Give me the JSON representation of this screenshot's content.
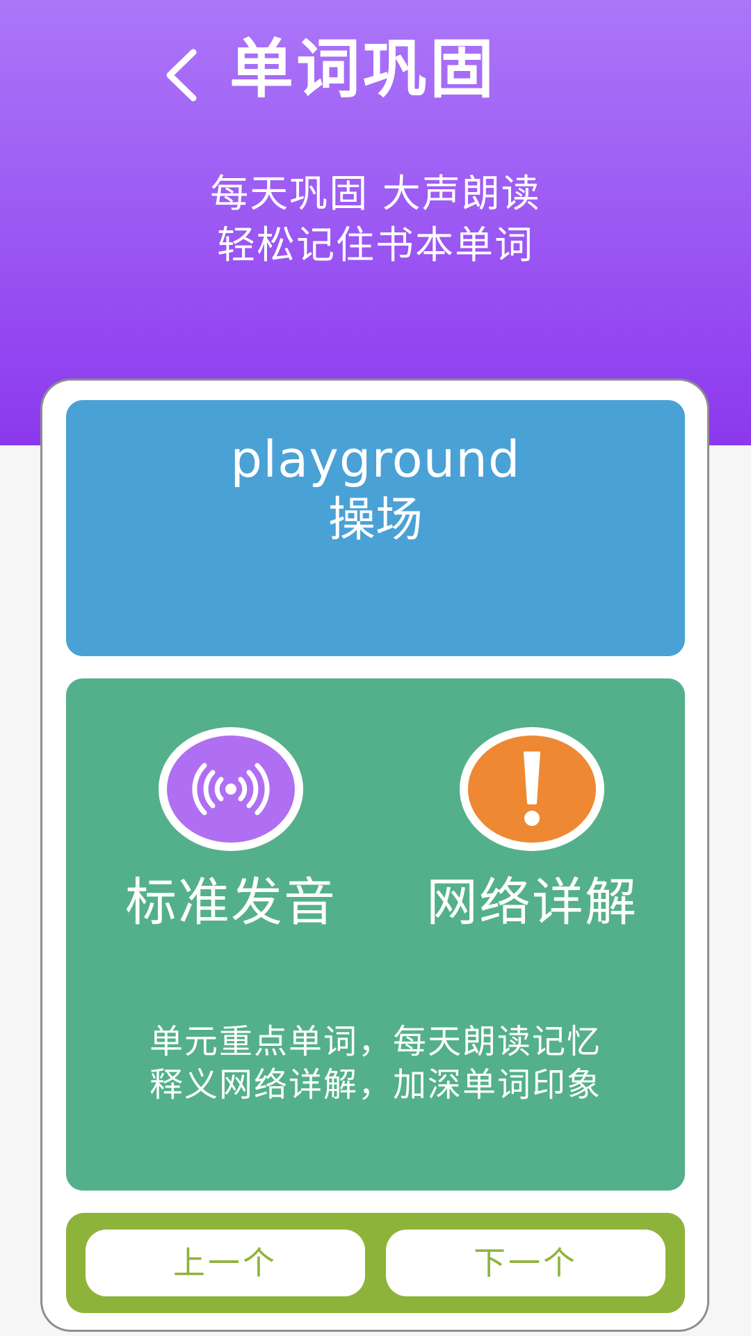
{
  "header": {
    "title": "单词巩固",
    "tagline_line1": "每天巩固 大声朗读",
    "tagline_line2": "轻松记住书本单词",
    "colors": {
      "gradient_top": "#ab76f8",
      "gradient_bottom": "#8c38ee"
    }
  },
  "word": {
    "english": "playground",
    "chinese": "操场",
    "panel_color": "#4aa1d6"
  },
  "actions": {
    "pronounce_label": "标准发音",
    "pronounce_icon": "audio-waves-icon",
    "pronounce_color": "#b06ff2",
    "details_label": "网络详解",
    "details_icon": "exclamation-icon",
    "details_color": "#ee8833",
    "description_line1": "单元重点单词，每天朗读记忆",
    "description_line2": "释义网络详解，加深单词印象",
    "panel_color": "#53b08b"
  },
  "navigation": {
    "prev_label": "上一个",
    "next_label": "下一个",
    "bar_color": "#8eb33a"
  }
}
